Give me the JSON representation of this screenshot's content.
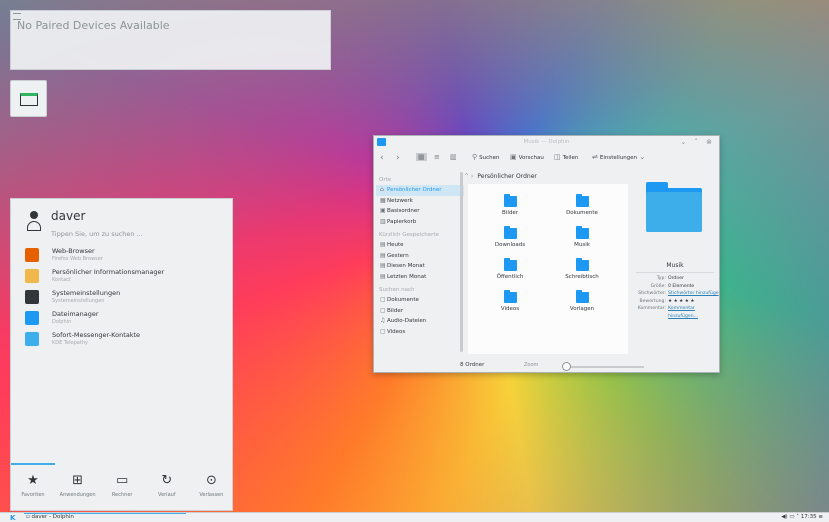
{
  "notification": {
    "text": "No Paired Devices Available"
  },
  "launcher": {
    "user_name": "daver",
    "search_hint": "Tippen Sie, um zu suchen ...",
    "apps": [
      {
        "name": "Web-Browser",
        "sub": "Firefox Web Browser",
        "color": "#e66000"
      },
      {
        "name": "Persönlicher Informationsmanager",
        "sub": "Kontact",
        "color": "#f0b84a"
      },
      {
        "name": "Systemeinstellungen",
        "sub": "Systemeinstellungen",
        "color": "#31363b"
      },
      {
        "name": "Dateimanager",
        "sub": "Dolphin",
        "color": "#1d99f3"
      },
      {
        "name": "Sofort-Messenger-Kontakte",
        "sub": "KDE Telepathy",
        "color": "#3daee9"
      }
    ],
    "tabs": [
      {
        "label": "Favoriten",
        "icon": "★"
      },
      {
        "label": "Anwendungen",
        "icon": "⊞"
      },
      {
        "label": "Rechner",
        "icon": "▭"
      },
      {
        "label": "Verlauf",
        "icon": "↻"
      },
      {
        "label": "Verlassen",
        "icon": "⊙"
      }
    ]
  },
  "dolphin": {
    "title": "Musik — Dolphin",
    "toolbar": {
      "search": "Suchen",
      "preview": "Vorschau",
      "split": "Teilen",
      "settings": "Einstellungen"
    },
    "breadcrumb": "Persönlicher Ordner",
    "sidebar": [
      {
        "type": "head",
        "label": "Orte"
      },
      {
        "type": "item",
        "label": "Persönlicher Ordner",
        "icon": "⌂",
        "selected": true
      },
      {
        "type": "item",
        "label": "Netzwerk",
        "icon": "▦"
      },
      {
        "type": "item",
        "label": "Basisordner",
        "icon": "▣"
      },
      {
        "type": "item",
        "label": "Papierkorb",
        "icon": "▥"
      },
      {
        "type": "head",
        "label": "Kürzlich Gespeicherte"
      },
      {
        "type": "item",
        "label": "Heute",
        "icon": "▤"
      },
      {
        "type": "item",
        "label": "Gestern",
        "icon": "▤"
      },
      {
        "type": "item",
        "label": "Diesen Monat",
        "icon": "▤"
      },
      {
        "type": "item",
        "label": "Letzten Monat",
        "icon": "▤"
      },
      {
        "type": "head",
        "label": "Suchen nach"
      },
      {
        "type": "item",
        "label": "Dokumente",
        "icon": "▢"
      },
      {
        "type": "item",
        "label": "Bilder",
        "icon": "▢"
      },
      {
        "type": "item",
        "label": "Audio-Dateien",
        "icon": "♫"
      },
      {
        "type": "item",
        "label": "Videos",
        "icon": "▢"
      }
    ],
    "folders": [
      "Bilder",
      "Dokumente",
      "Downloads",
      "Musik",
      "Öffentlich",
      "Schreibtisch",
      "Videos",
      "Vorlagen"
    ],
    "info": {
      "name": "Musik",
      "rows": [
        {
          "key": "Typ:",
          "value": "Ordner",
          "link": false
        },
        {
          "key": "Größe:",
          "value": "0 Elemente",
          "link": false
        },
        {
          "key": "Stichwörter:",
          "value": "Stichwörter hinzufüge",
          "link": true
        },
        {
          "key": "Bewertung:",
          "value": "★ ★ ★ ★ ★",
          "link": false
        },
        {
          "key": "Kommentar:",
          "value": "Kommentar",
          "link": true
        },
        {
          "key": "",
          "value": "hinzufügen...",
          "link": true
        }
      ]
    },
    "status": "8 Ordner",
    "zoom_label": "Zoom",
    "zoom_level": 0.15
  },
  "taskbar": {
    "task": "daver - Dolphin",
    "clock": "17:35"
  }
}
